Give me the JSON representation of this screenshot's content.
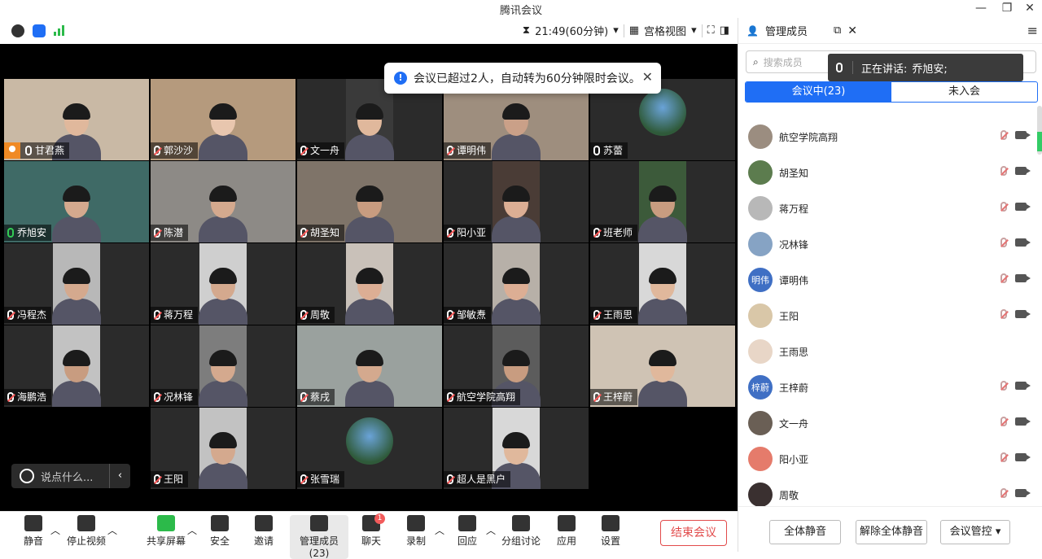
{
  "window": {
    "title": "腾讯会议",
    "controls": [
      "—",
      "❐",
      "✕"
    ]
  },
  "toolbar": {
    "timer": "21:49(60分钟)",
    "view": "宫格视图"
  },
  "toast": {
    "text": "会议已超过2人，自动转为60分钟限时会议。"
  },
  "tiles": [
    {
      "name": "甘君燕",
      "host": true,
      "mic": "on",
      "color": "#c9b9a5",
      "skin": "#e0b89c"
    },
    {
      "name": "郭沙沙",
      "mic": "muted",
      "color": "#b59a7d",
      "skin": "#e8c6ae"
    },
    {
      "name": "文一舟",
      "mic": "muted",
      "color": "#3a3a3a",
      "skin": "#e0b89c"
    },
    {
      "name": "谭明伟",
      "mic": "muted",
      "color": "#9e8e7e",
      "skin": "#caa088"
    },
    {
      "name": "苏蕾",
      "mic": "on",
      "circle": true,
      "color": "#2b2b2b"
    },
    {
      "name": "乔旭安",
      "mic": "green",
      "active": true,
      "color": "#3f6a66",
      "skin": "#d4a98e"
    },
    {
      "name": "陈潜",
      "mic": "muted",
      "color": "#8d8a86",
      "skin": "#d4a98e"
    },
    {
      "name": "胡圣知",
      "mic": "muted",
      "color": "#7f7469",
      "skin": "#c89c80"
    },
    {
      "name": "阳小亚",
      "mic": "muted",
      "color": "#4a3c36",
      "skin": "#dcae94"
    },
    {
      "name": "班老师",
      "mic": "muted",
      "color": "#3c5a3a",
      "skin": "#c89c80"
    },
    {
      "name": "冯程杰",
      "mic": "muted",
      "color": "#b8b8b8",
      "skin": "#d4a98e"
    },
    {
      "name": "蒋万程",
      "mic": "muted",
      "color": "#cfcfcf",
      "skin": "#d4a98e"
    },
    {
      "name": "周敬",
      "mic": "muted",
      "color": "#c9c1b9",
      "skin": "#dcae94"
    },
    {
      "name": "邹敏焘",
      "mic": "muted",
      "color": "#b7b0a8",
      "skin": "#dcae94"
    },
    {
      "name": "王雨思",
      "mic": "muted",
      "color": "#d8d8d8",
      "skin": "#e0b89c"
    },
    {
      "name": "海鹏浩",
      "mic": "muted",
      "color": "#c2c2c2",
      "skin": "#c89c80"
    },
    {
      "name": "况林锋",
      "mic": "muted",
      "color": "#7d7d7d",
      "skin": "#d4a98e"
    },
    {
      "name": "蔡戌",
      "mic": "muted",
      "color": "#9aa19e",
      "skin": "#d4a98e"
    },
    {
      "name": "航空学院高翔",
      "mic": "muted",
      "color": "#5c5c5c",
      "skin": "#c89c80"
    },
    {
      "name": "王梓蔚",
      "mic": "muted",
      "color": "#cfc3b4",
      "skin": "#e0b89c"
    },
    {
      "name": "王阳",
      "mic": "muted",
      "color": "#c2c2c2",
      "skin": "#d4a98e"
    },
    {
      "name": "张雪瑞",
      "mic": "muted",
      "circle": true,
      "color": "#2b2b2b"
    },
    {
      "name": "超人是黑户",
      "mic": "muted",
      "color": "#d8d8d8",
      "skin": "#e0b89c"
    }
  ],
  "chat": {
    "placeholder": "说点什么..."
  },
  "bottom": {
    "buttons": [
      "静音",
      "停止视频",
      "共享屏幕",
      "安全",
      "邀请",
      "管理成员(23)",
      "聊天",
      "录制",
      "回应",
      "分组讨论",
      "应用",
      "设置"
    ],
    "chat_badge": "1",
    "end": "结束会议"
  },
  "panel": {
    "title": "管理成员",
    "search_placeholder": "搜索成员",
    "speaking_label": "正在讲话:",
    "speaking_name": "乔旭安;",
    "tab_in": "会议中(23)",
    "tab_out": "未入会",
    "members": [
      {
        "name": "航空学院高翔",
        "avatar": "#9b8d80",
        "mic": true
      },
      {
        "name": "胡圣知",
        "avatar": "#5c7c4e",
        "mic": true
      },
      {
        "name": "蒋万程",
        "avatar": "#b8b8b8",
        "mic": true
      },
      {
        "name": "况林锋",
        "avatar": "#86a3c4",
        "mic": true
      },
      {
        "name": "谭明伟",
        "avatar": "#3f6fc4",
        "text": "明伟",
        "mic": true
      },
      {
        "name": "王阳",
        "avatar": "#d9c7a8",
        "mic": true
      },
      {
        "name": "王雨思",
        "avatar": "#e8d6c7",
        "mic": false
      },
      {
        "name": "王梓蔚",
        "avatar": "#3f6fc4",
        "text": "梓蔚",
        "mic": true
      },
      {
        "name": "文一舟",
        "avatar": "#6a5f55",
        "mic": true
      },
      {
        "name": "阳小亚",
        "avatar": "#e57b6b",
        "mic": true
      },
      {
        "name": "周敬",
        "avatar": "#3a3030",
        "mic": true
      }
    ],
    "mute_all": "全体静音",
    "unmute_all": "解除全体静音",
    "control": "会议管控"
  }
}
